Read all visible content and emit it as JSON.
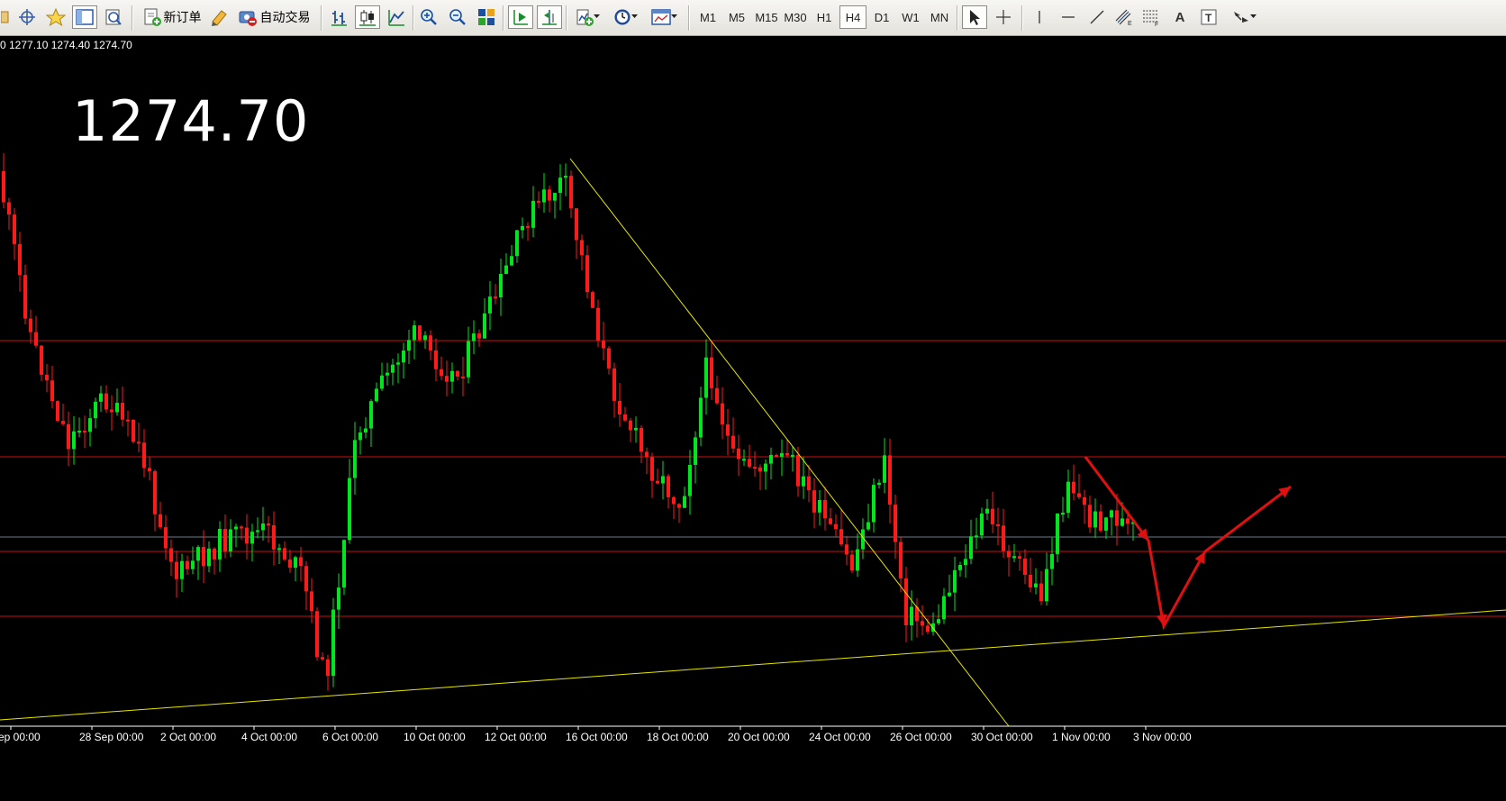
{
  "toolbar": {
    "new_order_label": "新订单",
    "auto_trade_label": "自动交易",
    "timeframes": [
      "M1",
      "M5",
      "M15",
      "M30",
      "H1",
      "H4",
      "D1",
      "W1",
      "MN"
    ],
    "active_timeframe": "H4",
    "text_tool_label": "A"
  },
  "chart": {
    "ohlc_text": "0 1277.10 1274.40 1274.70",
    "big_price": "1274.70",
    "x_axis_labels": [
      "ep 00:00",
      "28 Sep 00:00",
      "2 Oct 00:00",
      "4 Oct 00:00",
      "6 Oct 00:00",
      "10 Oct 00:00",
      "12 Oct 00:00",
      "16 Oct 00:00",
      "18 Oct 00:00",
      "20 Oct 00:00",
      "24 Oct 00:00",
      "26 Oct 00:00",
      "30 Oct 00:00",
      "1 Nov 00:00",
      "3 Nov 00:00"
    ],
    "colors": {
      "background": "#000000",
      "bull_candle": "#00e61e",
      "bear_candle": "#ff1a1a",
      "horizontal_line": "#cc1010",
      "trend_line": "#e6e600",
      "current_price_line": "#6a7a8c",
      "arrow": "#e01010"
    }
  }
}
